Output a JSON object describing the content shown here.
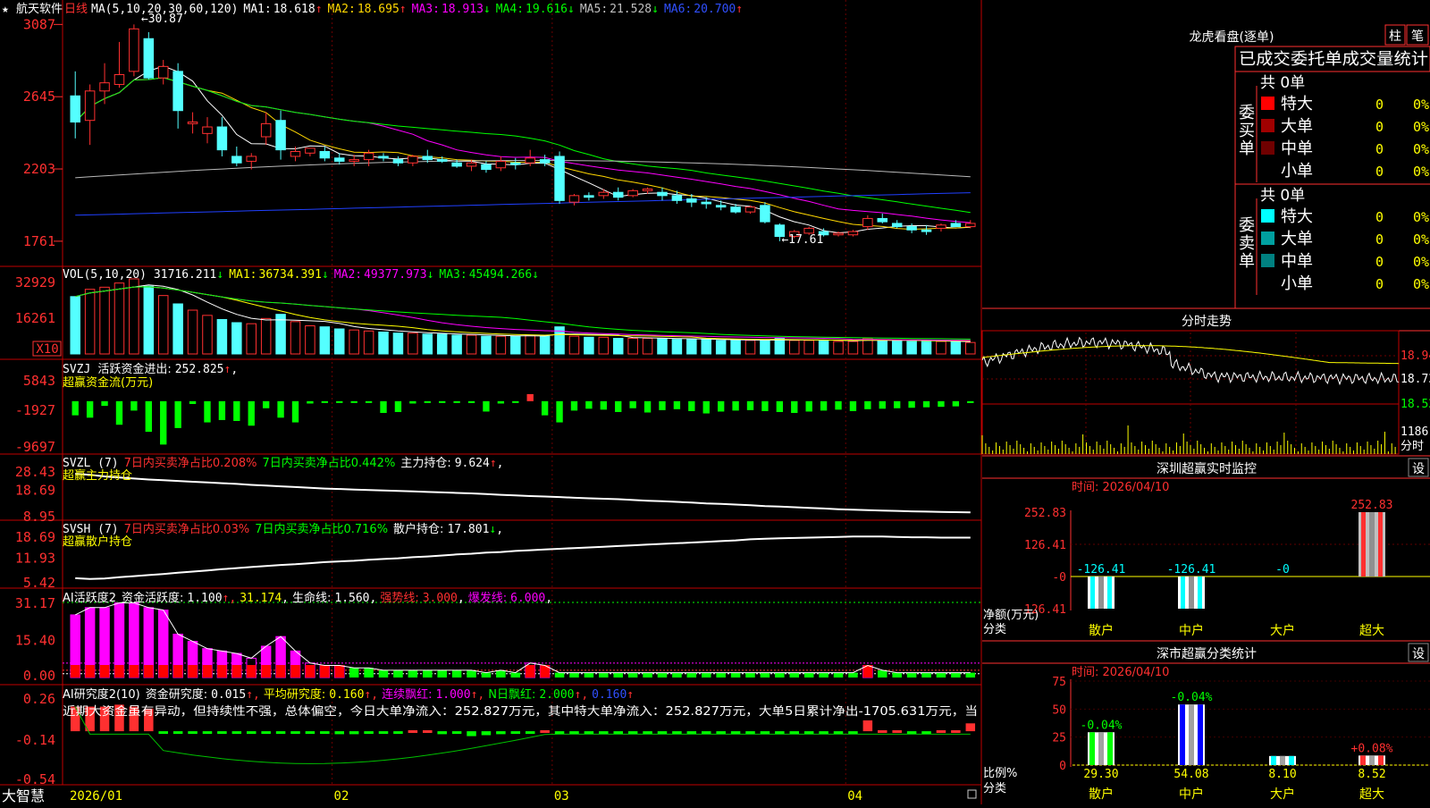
{
  "stock": {
    "name": "航天软件",
    "period": "日线",
    "ma_label": "MA(5,10,20,30,60,120)",
    "ma": [
      {
        "label": "MA1:",
        "value": "18.618",
        "arrow": "↑",
        "color": "#ffffff"
      },
      {
        "label": "MA2:",
        "value": "18.695",
        "arrow": "↑",
        "color": "#ffd700"
      },
      {
        "label": "MA3:",
        "value": "18.913",
        "arrow": "↓",
        "color": "#ff00ff"
      },
      {
        "label": "MA4:",
        "value": "19.616",
        "arrow": "↓",
        "color": "#00ff00"
      },
      {
        "label": "MA5:",
        "value": "21.528",
        "arrow": "↓",
        "color": "#c0c0c0"
      },
      {
        "label": "MA6:",
        "value": "20.700",
        "arrow": "↑",
        "color": "#3050ff"
      }
    ],
    "high_mark": "30.87",
    "low_mark": "17.61"
  },
  "colors": {
    "up": "#ff3030",
    "down": "#54ffff",
    "grid": "#c00000",
    "neg_bar": "#00ff00",
    "label_red": "#ff3030",
    "label_yellow": "#ffff00",
    "label_green": "#00ff00"
  },
  "axes": {
    "price": [
      "3087",
      "2645",
      "2203",
      "1761"
    ],
    "volume": [
      "32929",
      "16261",
      "X10"
    ],
    "svzj": [
      "5843",
      "-1927",
      "-9697"
    ],
    "svzl": [
      "28.43",
      "18.69",
      "8.95"
    ],
    "svsh": [
      "18.69",
      "11.93",
      "5.42"
    ],
    "ai_active": [
      "31.17",
      "15.40",
      "0.00"
    ],
    "ai_research": [
      "0.26",
      "-0.14",
      "-0.54"
    ]
  },
  "panels": {
    "volume": {
      "label": "VOL(5,10,20)",
      "value": "31716.211",
      "arrow": "↓",
      "ma": [
        {
          "label": "MA1:",
          "value": "36734.391",
          "arrow": "↓",
          "color": "#ffff00"
        },
        {
          "label": "MA2:",
          "value": "49377.973",
          "arrow": "↓",
          "color": "#ff00ff"
        },
        {
          "label": "MA3:",
          "value": "45494.266",
          "arrow": "↓",
          "color": "#00ff00"
        }
      ]
    },
    "svzj": {
      "label": "SVZJ",
      "active_label": "活跃资金进出:",
      "active_value": "252.825",
      "arrow": "↑",
      "sub": "超赢资金流(万元)"
    },
    "svzl": {
      "label": "SVZL (7)",
      "t1": "7日内买卖净占比0.208%",
      "t2": "7日内买卖净占比0.442%",
      "t3_label": "主力持仓:",
      "t3_value": "9.624",
      "arrow": "↑",
      "sub": "超赢主力持仓"
    },
    "svsh": {
      "label": "SVSH (7)",
      "t1": "7日内买卖净占比0.03%",
      "t2": "7日内买卖净占比0.716%",
      "t3_label": "散户持仓:",
      "t3_value": "17.801",
      "arrow": "↓",
      "sub": "超赢散户持仓"
    },
    "ai_active": {
      "label": "AI活跃度2",
      "a_label": "资金活跃度:",
      "a_value": "1.100",
      "b_value": "31.174",
      "c_label": "生命线:",
      "c_value": "1.560",
      "d_label": "强势线:",
      "d_value": "3.000",
      "e_label": "爆发线:",
      "e_value": "6.000"
    },
    "ai_research": {
      "label": "AI研究度2(10)",
      "a_label": "资金研究度:",
      "a_value": "0.015",
      "b_label": "平均研究度:",
      "b_value": "0.160",
      "c_label": "连续飘红:",
      "c_value": "1.000",
      "d_label": "N日飘红:",
      "d_value": "2.000",
      "e_value": "0.160",
      "comment": "近期大资金虽有异动，但持续性不强，总体偏空，今日大单净流入：252.827万元，其中特大单净流入：252.827万元，大单5日累计净出-1705.631万元，当"
    }
  },
  "dates": {
    "brand": "大智慧",
    "labels": [
      "2026/01",
      "02",
      "03",
      "04"
    ]
  },
  "longhu": {
    "title": "龙虎看盘(逐单)",
    "btn_bar": "柱",
    "btn_pen": "笔",
    "header": "已成交委托单成交量统计",
    "buy": {
      "side": "委买单",
      "total": "共 0单",
      "rows": [
        {
          "label": "特大",
          "value": "0",
          "pct": "0%",
          "color": "#ff0000"
        },
        {
          "label": "大单",
          "value": "0",
          "pct": "0%",
          "color": "#a00000"
        },
        {
          "label": "中单",
          "value": "0",
          "pct": "0%",
          "color": "#700000"
        },
        {
          "label": "小单",
          "value": "0",
          "pct": "0%",
          "color": "#000000"
        }
      ]
    },
    "sell": {
      "side": "委卖单",
      "total": "共 0单",
      "rows": [
        {
          "label": "特大",
          "value": "0",
          "pct": "0%",
          "color": "#00ffff"
        },
        {
          "label": "大单",
          "value": "0",
          "pct": "0%",
          "color": "#00a0a0"
        },
        {
          "label": "中单",
          "value": "0",
          "pct": "0%",
          "color": "#008080"
        },
        {
          "label": "小单",
          "value": "0",
          "pct": "0%",
          "color": "#000000"
        }
      ]
    }
  },
  "intraday": {
    "title": "分时走势",
    "prices": [
      "18.94",
      "18.73",
      "18.52"
    ],
    "volume_max": "1186",
    "volume_label": "分时"
  },
  "monitor": {
    "title": "深圳超赢实时监控",
    "btn": "设",
    "time": "时间: 2026/04/10",
    "y_ticks": [
      "252.83",
      "126.41",
      "-0",
      "-126.41"
    ],
    "ylabel": "净额(万元)",
    "xlabel": "分类"
  },
  "classify": {
    "title": "深市超赢分类统计",
    "btn": "设",
    "time": "时间: 2026/04/10",
    "y_ticks": [
      "75",
      "50",
      "25",
      "0"
    ],
    "ylabel": "比例%",
    "xlabel": "分类"
  },
  "chart_data": [
    {
      "type": "candlestick",
      "title": "航天软件 日线",
      "y_ticks": [
        "3087",
        "2645",
        "2203",
        "1761"
      ],
      "x_ticks": [
        "2026/01",
        "02",
        "03",
        "04"
      ],
      "ohlc": [
        [
          26.5,
          28.0,
          23.9,
          24.9
        ],
        [
          25.0,
          27.2,
          23.5,
          26.8
        ],
        [
          26.8,
          28.5,
          26.0,
          27.3
        ],
        [
          27.2,
          29.8,
          27.0,
          27.8
        ],
        [
          28.0,
          30.87,
          27.7,
          30.6
        ],
        [
          30.0,
          30.4,
          27.5,
          27.6
        ],
        [
          27.6,
          28.7,
          27.2,
          28.3
        ],
        [
          28.0,
          28.5,
          24.5,
          25.6
        ],
        [
          24.8,
          25.5,
          24.2,
          24.9
        ],
        [
          24.2,
          25.2,
          23.6,
          24.6
        ],
        [
          24.6,
          25.2,
          22.8,
          23.2
        ],
        [
          22.8,
          23.4,
          22.2,
          22.4
        ],
        [
          22.5,
          23.0,
          22.0,
          22.8
        ],
        [
          24.0,
          25.5,
          23.5,
          24.8
        ],
        [
          25.0,
          25.6,
          22.6,
          23.2
        ],
        [
          22.8,
          23.4,
          22.5,
          23.1
        ],
        [
          23.0,
          23.3,
          22.8,
          23.3
        ],
        [
          23.1,
          23.4,
          22.5,
          22.7
        ],
        [
          22.7,
          23.0,
          22.3,
          22.5
        ],
        [
          22.5,
          22.9,
          22.2,
          22.6
        ],
        [
          22.6,
          23.2,
          22.2,
          23.0
        ],
        [
          22.8,
          23.0,
          22.5,
          22.7
        ],
        [
          22.6,
          22.8,
          22.2,
          22.4
        ],
        [
          22.4,
          22.9,
          22.2,
          22.8
        ],
        [
          22.8,
          23.2,
          22.4,
          22.6
        ],
        [
          22.6,
          22.8,
          22.4,
          22.5
        ],
        [
          22.4,
          22.6,
          22.1,
          22.2
        ],
        [
          22.2,
          22.6,
          21.9,
          22.4
        ],
        [
          22.3,
          22.5,
          21.8,
          22.0
        ],
        [
          22.1,
          22.8,
          21.9,
          22.5
        ],
        [
          22.4,
          22.7,
          22.0,
          22.3
        ],
        [
          22.4,
          23.2,
          22.2,
          22.7
        ],
        [
          22.6,
          22.9,
          22.2,
          22.4
        ],
        [
          22.8,
          23.1,
          19.9,
          20.1
        ],
        [
          20.0,
          20.5,
          19.8,
          20.4
        ],
        [
          20.4,
          20.6,
          20.1,
          20.3
        ],
        [
          20.4,
          20.8,
          20.2,
          20.6
        ],
        [
          20.6,
          20.9,
          20.1,
          20.3
        ],
        [
          20.4,
          20.8,
          20.3,
          20.7
        ],
        [
          20.7,
          20.9,
          20.5,
          20.8
        ],
        [
          20.6,
          20.9,
          20.1,
          20.4
        ],
        [
          20.4,
          20.7,
          19.9,
          20.1
        ],
        [
          20.2,
          20.5,
          19.7,
          20.0
        ],
        [
          20.0,
          20.3,
          19.6,
          19.9
        ],
        [
          19.8,
          20.1,
          19.5,
          19.7
        ],
        [
          19.7,
          19.9,
          19.3,
          19.4
        ],
        [
          19.4,
          19.8,
          19.3,
          19.7
        ],
        [
          19.8,
          20.0,
          18.7,
          18.8
        ],
        [
          18.6,
          18.7,
          17.61,
          17.9
        ],
        [
          17.9,
          18.3,
          17.8,
          18.2
        ],
        [
          18.1,
          18.5,
          18.0,
          18.4
        ],
        [
          18.2,
          18.4,
          17.9,
          18.0
        ],
        [
          18.0,
          18.2,
          17.9,
          18.1
        ],
        [
          18.0,
          18.3,
          17.9,
          18.2
        ],
        [
          18.5,
          19.2,
          18.3,
          19.0
        ],
        [
          19.0,
          19.3,
          18.7,
          18.8
        ],
        [
          18.7,
          18.9,
          18.4,
          18.5
        ],
        [
          18.5,
          18.7,
          18.1,
          18.3
        ],
        [
          18.3,
          18.6,
          18.0,
          18.2
        ],
        [
          18.4,
          18.7,
          18.2,
          18.6
        ],
        [
          18.7,
          18.9,
          18.5,
          18.5
        ],
        [
          18.5,
          18.9,
          18.4,
          18.7
        ]
      ]
    },
    {
      "type": "bar",
      "title": "VOL",
      "values": [
        55,
        62,
        64,
        68,
        72,
        65,
        56,
        48,
        42,
        37,
        33,
        30,
        29,
        34,
        38,
        31,
        27,
        26,
        24,
        23,
        22,
        21,
        20,
        20,
        19,
        19,
        18,
        18,
        17,
        17,
        17,
        18,
        17,
        26,
        17,
        16,
        16,
        15,
        15,
        15,
        15,
        14,
        14,
        14,
        13,
        13,
        13,
        13,
        15,
        13,
        13,
        13,
        12,
        12,
        15,
        13,
        13,
        12,
        12,
        12,
        12,
        11
      ]
    },
    {
      "type": "bar",
      "title": "超赢资金流(万元)",
      "values": [
        -3000,
        -3500,
        -1000,
        -5000,
        -2000,
        -6500,
        -9200,
        -5700,
        -600,
        -4500,
        -4000,
        -4200,
        -5200,
        -1500,
        -3500,
        -4500,
        -500,
        -300,
        -200,
        -250,
        -300,
        -2500,
        -2300,
        -500,
        -150,
        -300,
        -200,
        -400,
        -2200,
        -500,
        -300,
        1500,
        -3000,
        -4500,
        -2000,
        -1600,
        -1800,
        -2300,
        -1500,
        -2400,
        -1900,
        -1700,
        -2100,
        -2600,
        -2200,
        -2000,
        -1900,
        -2100,
        -2300,
        -2500,
        -2200,
        -2000,
        -1800,
        -2100,
        -1700,
        -1600,
        -1500,
        -1400,
        -1300,
        -1200,
        -1100,
        -400
      ]
    },
    {
      "type": "line",
      "title": "超赢主力持仓",
      "values": [
        25.5,
        25.0,
        24.4,
        23.9,
        23.5,
        23.1,
        22.8,
        22.5,
        22.2,
        21.9,
        21.6,
        21.3,
        20.9,
        20.6,
        20.3,
        20.0,
        19.7,
        19.4,
        19.2,
        19.0,
        18.8,
        18.6,
        18.4,
        18.2,
        18.0,
        17.8,
        17.6,
        17.4,
        17.1,
        16.8,
        16.6,
        16.3,
        16.1,
        15.9,
        15.6,
        15.4,
        15.2,
        15.0,
        14.7,
        14.4,
        14.2,
        13.9,
        13.6,
        13.3,
        13.1,
        12.8,
        12.5,
        12.2,
        12.0,
        11.7,
        11.4,
        11.2,
        10.9,
        10.7,
        10.5,
        10.3,
        10.2,
        10.0,
        9.9,
        9.8,
        9.7,
        9.6
      ]
    },
    {
      "type": "line",
      "title": "超赢散户持仓",
      "values": [
        6.2,
        6.0,
        6.1,
        6.5,
        6.8,
        7.1,
        7.4,
        7.8,
        8.1,
        8.4,
        8.8,
        9.1,
        9.4,
        9.7,
        10.0,
        10.2,
        10.5,
        10.8,
        11.0,
        11.2,
        11.5,
        11.7,
        11.9,
        12.2,
        12.4,
        12.7,
        13.0,
        13.2,
        13.5,
        13.7,
        14.0,
        14.2,
        14.4,
        14.6,
        14.8,
        15.0,
        15.2,
        15.4,
        15.6,
        15.8,
        16.0,
        16.2,
        16.4,
        16.6,
        16.8,
        17.0,
        17.3,
        17.5,
        17.6,
        17.7,
        17.8,
        17.9,
        18.0,
        18.1,
        18.1,
        18.1,
        18.0,
        17.9,
        17.9,
        17.8,
        17.8,
        17.8
      ]
    },
    {
      "type": "bar",
      "title": "AI活跃度2",
      "series": [
        {
          "name": "资金活跃度",
          "values": [
            26,
            29,
            29,
            31,
            31,
            29,
            28,
            18,
            15,
            12,
            11,
            10,
            8,
            13,
            17,
            11,
            6,
            5,
            5,
            4,
            4,
            3,
            3,
            3,
            3,
            3,
            3,
            3,
            2,
            3,
            2,
            6,
            5,
            2,
            2,
            2,
            2,
            2,
            2,
            2,
            2,
            2,
            2,
            2,
            2,
            2,
            2,
            2,
            2,
            2,
            2,
            2,
            2,
            2,
            5,
            3,
            2,
            2,
            2,
            2,
            2,
            2
          ]
        },
        {
          "name": "生命线",
          "values": [
            1.56
          ]
        },
        {
          "name": "强势线",
          "values": [
            3.0
          ]
        },
        {
          "name": "爆发线",
          "values": [
            6.0
          ]
        }
      ]
    },
    {
      "type": "bar",
      "title": "AI研究度2(10)",
      "values": [
        0.2,
        0.2,
        0.2,
        0.22,
        0.2,
        0.18,
        -0.05,
        -0.05,
        -0.06,
        -0.06,
        -0.05,
        -0.05,
        -0.06,
        -0.06,
        -0.05,
        -0.05,
        -0.05,
        -0.06,
        -0.08,
        -0.08,
        -0.06,
        -0.05,
        -0.05,
        -0.04,
        -0.04,
        -0.08,
        -0.06,
        -0.1,
        -0.09,
        -0.08,
        -0.06,
        -0.05,
        -0.04,
        -0.05,
        -0.06,
        -0.08,
        -0.08,
        -0.06,
        -0.05,
        -0.06,
        -0.07,
        -0.08,
        -0.08,
        -0.07,
        -0.06,
        -0.05,
        -0.06,
        -0.08,
        -0.06,
        -0.05,
        -0.06,
        -0.06,
        -0.05,
        -0.05,
        0.06,
        -0.04,
        -0.04,
        -0.05,
        -0.05,
        -0.04,
        -0.04,
        0.03
      ]
    },
    {
      "type": "bar",
      "title": "深圳超赢实时监控",
      "categories": [
        "散户",
        "中户",
        "大户",
        "超大"
      ],
      "values": [
        -126.41,
        -126.41,
        0,
        252.83
      ],
      "labels": [
        "-126.41",
        "-126.41",
        "-0",
        "252.83"
      ],
      "ylabel": "净额(万元)",
      "xlabel": "分类"
    },
    {
      "type": "bar",
      "title": "深市超赢分类统计",
      "categories": [
        "散户",
        "中户",
        "大户",
        "超大"
      ],
      "values": [
        29.3,
        54.08,
        8.1,
        8.52
      ],
      "changes": [
        "-0.04%",
        "-0.04%",
        "",
        "+0.08%"
      ],
      "ylabel": "比例%",
      "xlabel": "分类",
      "ylim": [
        0,
        75
      ]
    }
  ]
}
